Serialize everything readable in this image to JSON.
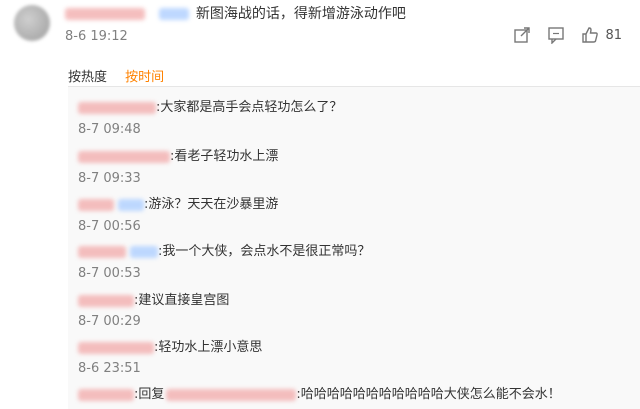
{
  "main_comment": {
    "text": "新图海战的话，得新增游泳动作吧",
    "time": "8-6 19:12",
    "likes": "81",
    "icons": [
      "share-icon",
      "comment-icon",
      "like-icon"
    ]
  },
  "sort": {
    "hot": "按热度",
    "time": "按时间"
  },
  "replies": [
    {
      "text": ":大家都是高手会点轻功怎么了？",
      "time": "8-7 09:48"
    },
    {
      "text": ":看老子轻功水上漂",
      "time": "8-7 09:33"
    },
    {
      "text": ":游泳？天天在沙暴里游",
      "time": "8-7 00:56"
    },
    {
      "text": ":我一个大侠，会点水不是很正常吗？",
      "time": "8-7 00:53"
    },
    {
      "text": ":建议直接皇宫图",
      "time": "8-7 00:29"
    },
    {
      "text": ":轻功水上漂小意思",
      "time": "8-6 23:51"
    },
    {
      "prefix": ":回复",
      "text": ":哈哈哈哈哈哈哈哈哈哈哈大侠怎么能不会水！"
    }
  ],
  "colors": {
    "accent": "#ff8200",
    "time": "#808080"
  }
}
